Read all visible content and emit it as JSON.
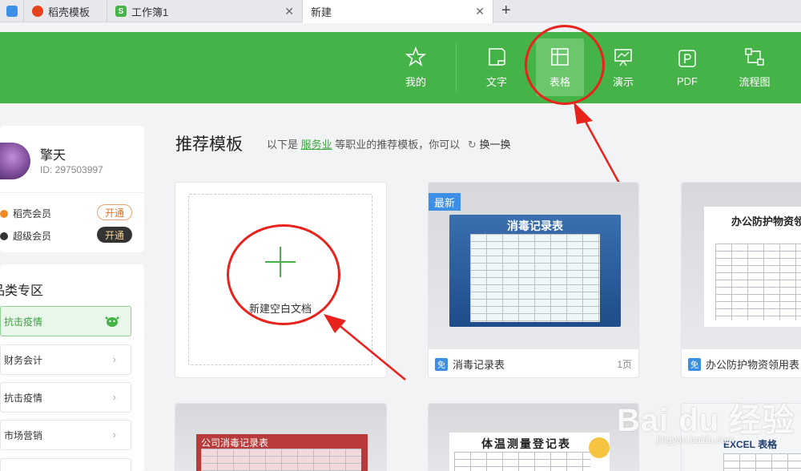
{
  "tabs": [
    {
      "label": "",
      "icon": "app-icon",
      "color": "#3d8fe6"
    },
    {
      "label": "稻壳模板",
      "icon": "docer-icon",
      "color": "#e8421c"
    },
    {
      "label": "工作簿1",
      "icon": "spreadsheet-icon",
      "color": "#45b347",
      "glyph": "S"
    },
    {
      "label": "新建",
      "active": true
    }
  ],
  "header": {
    "accent": "#45b347",
    "nav": [
      {
        "label": "我的",
        "icon": "star-icon"
      },
      {
        "label": "文字",
        "icon": "document-icon"
      },
      {
        "label": "表格",
        "icon": "table-icon",
        "active": true
      },
      {
        "label": "演示",
        "icon": "presentation-icon"
      },
      {
        "label": "PDF",
        "icon": "pdf-icon"
      },
      {
        "label": "流程图",
        "icon": "flowchart-icon"
      }
    ]
  },
  "user": {
    "name": "擎天",
    "id": "ID: 297503997"
  },
  "membership": [
    {
      "label": "稻壳会员",
      "button": "开通",
      "dot": "#f08a24"
    },
    {
      "label": "超级会员",
      "button": "开通",
      "dot": "#333333"
    }
  ],
  "categories": {
    "title": "品类专区",
    "items": [
      {
        "label": "抗击疫情",
        "active": true
      },
      {
        "label": "财务会计"
      },
      {
        "label": "抗击疫情"
      },
      {
        "label": "市场营销"
      }
    ]
  },
  "main": {
    "title": "推荐模板",
    "subtitle_prefix": "以下是",
    "subtitle_link": "服务业",
    "subtitle_suffix": "等职业的推荐模板，你可以",
    "refresh_label": "换一换",
    "blank_label": "新建空白文档",
    "templates": [
      {
        "title": "消毒记录表",
        "badge": "最新",
        "free": "免",
        "pages": "1页",
        "thumb_title": "消毒记录表"
      },
      {
        "title": "办公防护物资领用表",
        "free": "免",
        "thumb_title": "办公防护物资领"
      },
      {
        "thumb_title": "公司消毒记录表"
      },
      {
        "thumb_title": "体温测量登记表"
      },
      {
        "thumb_title": "EXCEL 表格"
      }
    ]
  },
  "watermark": {
    "text": "Bai du 经验",
    "sub": "jingyan.baidu.com"
  }
}
